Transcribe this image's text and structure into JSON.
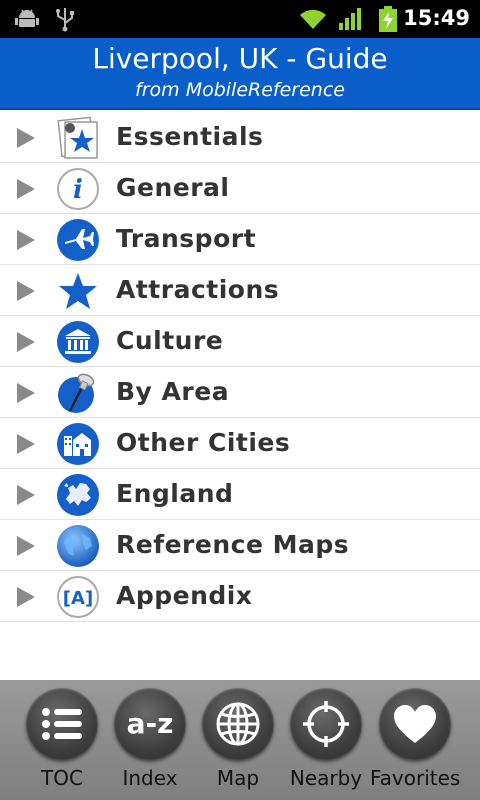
{
  "status_bar": {
    "time": "15:49",
    "icons": [
      "android-debug-icon",
      "usb-icon",
      "wifi-icon",
      "signal-icon",
      "battery-charging-icon"
    ]
  },
  "header": {
    "title": "Liverpool, UK - Guide",
    "subtitle": "from MobileReference",
    "color": "#0a5ec9"
  },
  "menu": {
    "items": [
      {
        "label": "Essentials",
        "icon": "essentials-star-card-icon"
      },
      {
        "label": "General",
        "icon": "info-icon"
      },
      {
        "label": "Transport",
        "icon": "airplane-icon"
      },
      {
        "label": "Attractions",
        "icon": "star-icon"
      },
      {
        "label": "Culture",
        "icon": "museum-icon"
      },
      {
        "label": "By Area",
        "icon": "pushpin-icon"
      },
      {
        "label": "Other Cities",
        "icon": "city-buildings-icon"
      },
      {
        "label": "England",
        "icon": "europe-map-icon"
      },
      {
        "label": "Reference Maps",
        "icon": "globe-icon"
      },
      {
        "label": "Appendix",
        "icon": "appendix-bracket-a-icon"
      }
    ]
  },
  "toolbar": {
    "buttons": [
      {
        "label": "TOC",
        "icon": "list-icon"
      },
      {
        "label": "Index",
        "icon": "a-z-icon"
      },
      {
        "label": "Map",
        "icon": "globe-grid-icon"
      },
      {
        "label": "Nearby",
        "icon": "crosshair-icon"
      },
      {
        "label": "Favorites",
        "icon": "heart-icon"
      }
    ],
    "az_text": "a-z"
  },
  "icon_text": {
    "info": "i",
    "appendix": "[A]"
  }
}
